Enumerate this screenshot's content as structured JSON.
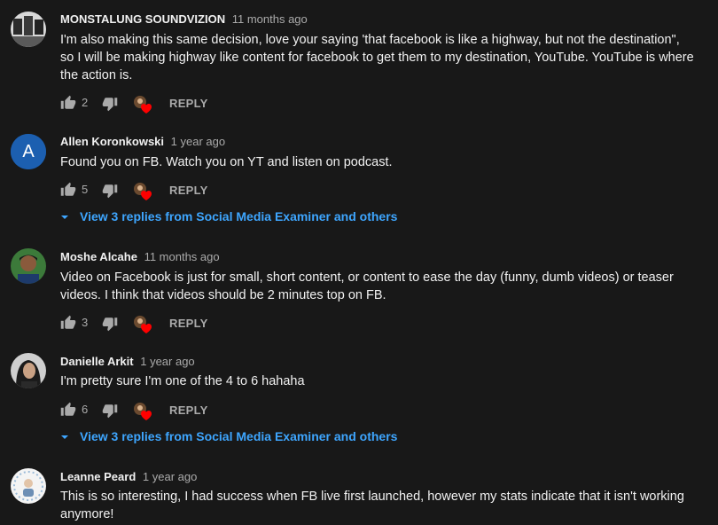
{
  "colors": {
    "background": "#181818",
    "link": "#3ea6ff",
    "heart": "#ff0000",
    "muted": "#aaaaaa"
  },
  "comments": [
    {
      "author": "MONSTALUNG SOUNDVIZION",
      "time": "11 months ago",
      "text": "I'm also making this same decision, love your saying 'that facebook is like a highway, but not the destination\", so I will be making highway like content for facebook to get them to my destination, YouTube. YouTube is where the action is.",
      "likes": "2",
      "reply_label": "REPLY",
      "avatar_icon": "photo-avatar"
    },
    {
      "author": "Allen Koronkowski",
      "time": "1 year ago",
      "text": "Found you on FB. Watch you on YT and listen on podcast.",
      "likes": "5",
      "reply_label": "REPLY",
      "avatar_letter": "A",
      "replies_link": "View 3 replies from Social Media Examiner and others"
    },
    {
      "author": "Moshe Alcahe",
      "time": "11 months ago",
      "text": "Video on Facebook is just for small, short content, or content to ease the day (funny, dumb videos) or teaser videos. I think that videos should be 2 minutes top on FB.",
      "likes": "3",
      "reply_label": "REPLY",
      "avatar_icon": "photo-avatar"
    },
    {
      "author": "Danielle Arkit",
      "time": "1 year ago",
      "text": "I'm pretty sure I'm one of the 4 to 6 hahaha",
      "likes": "6",
      "reply_label": "REPLY",
      "avatar_icon": "photo-avatar",
      "replies_link": "View 3 replies from Social Media Examiner and others"
    },
    {
      "author": "Leanne Peard",
      "time": "1 year ago",
      "text": "This is so interesting, I had success when FB live first launched, however my stats indicate that it isn't working anymore!",
      "avatar_icon": "photo-avatar"
    }
  ],
  "icons": {
    "like": "thumbs-up-icon",
    "dislike": "thumbs-down-icon",
    "heart": "creator-heart-icon",
    "chevron": "chevron-down-icon"
  }
}
